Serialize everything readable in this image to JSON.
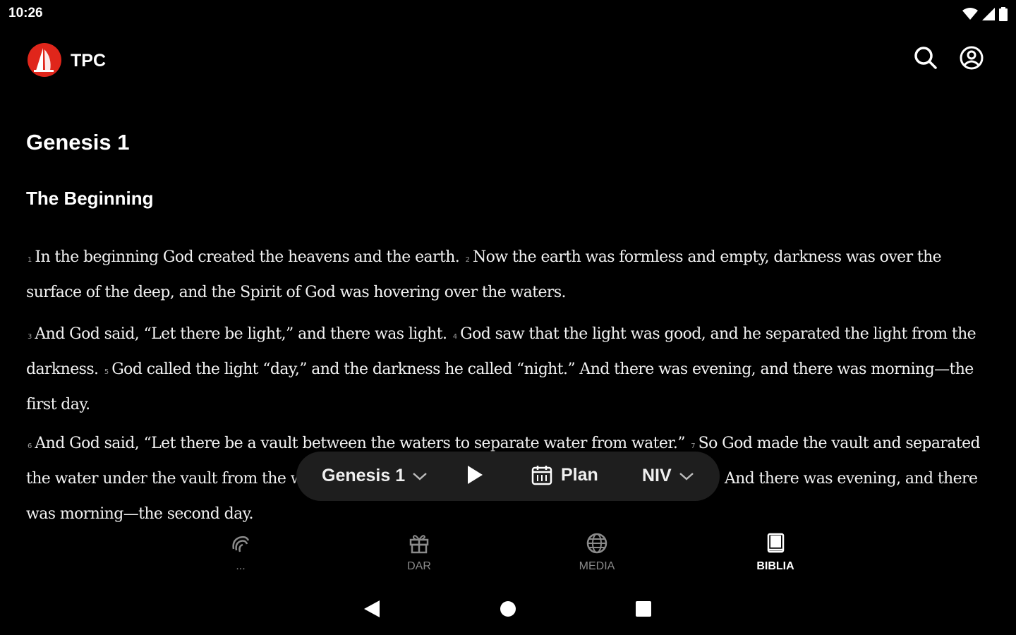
{
  "status_bar": {
    "time": "10:26"
  },
  "app_bar": {
    "brand": "TPC"
  },
  "reader": {
    "chapter_title": "Genesis 1",
    "section_title": "The Beginning",
    "paragraphs": [
      {
        "verses": [
          {
            "num": "1",
            "text": "In the beginning God created the heavens and the earth."
          },
          {
            "num": "2",
            "text": "Now the earth was formless and empty, darkness was over the surface of the deep, and the Spirit of God was hovering over the waters."
          }
        ]
      },
      {
        "verses": [
          {
            "num": "3",
            "text": "And God said, “Let there be light,” and there was light."
          },
          {
            "num": "4",
            "text": "God saw that the light was good, and he separated the light from the darkness."
          },
          {
            "num": "5",
            "text": "God called the light “day,” and the darkness he called “night.” And there was evening, and there was morning—the first day."
          }
        ]
      },
      {
        "verses": [
          {
            "num": "6",
            "text": "And God said, “Let there be a vault between the waters to separate water from water.”"
          },
          {
            "num": "7",
            "text": "So God made the vault and separated the water under the vault from the water above it. And it was so."
          },
          {
            "num": "8",
            "text": "God called the vault “sky.” And there was evening, and there was morning—the second day."
          }
        ]
      }
    ]
  },
  "player": {
    "chapter": "Genesis 1",
    "plan": "Plan",
    "version": "NIV"
  },
  "bottom_nav": [
    {
      "label": "...",
      "icon": "tithe-icon",
      "active": false
    },
    {
      "label": "DAR",
      "icon": "gift-icon",
      "active": false
    },
    {
      "label": "MEDIA",
      "icon": "globe-icon",
      "active": false
    },
    {
      "label": "BIBLIA",
      "icon": "book-icon",
      "active": true
    }
  ],
  "colors": {
    "background": "#000000",
    "pill": "#1e1e1e",
    "brand_red": "#e0261b",
    "muted": "#8a8a8a"
  }
}
